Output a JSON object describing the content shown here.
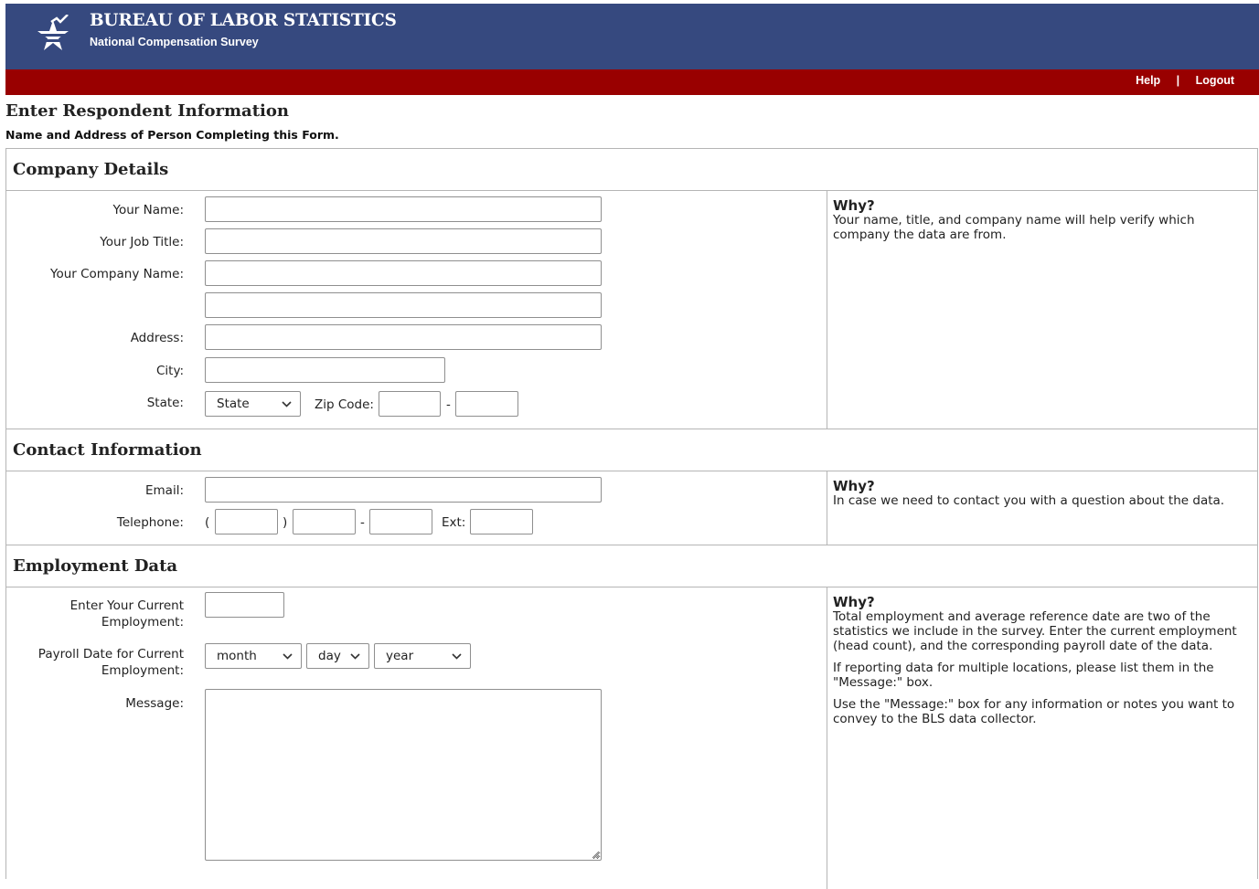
{
  "header": {
    "org_title": "BUREAU OF LABOR STATISTICS",
    "org_subtitle": "National Compensation Survey",
    "links": {
      "help": "Help",
      "separator": "|",
      "logout": "Logout"
    },
    "colors": {
      "banner": "#36497f",
      "bar": "#990000"
    }
  },
  "page": {
    "title": "Enter Respondent Information",
    "subtitle": "Name and Address of Person Completing this Form."
  },
  "company": {
    "heading": "Company Details",
    "labels": {
      "name": "Your Name:",
      "job_title": "Your Job Title:",
      "company_name": "Your Company Name:",
      "address": "Address:",
      "city": "City:",
      "state": "State:",
      "zip": "Zip Code:",
      "zip_dash": "-"
    },
    "values": {
      "name": "",
      "job_title": "",
      "company_name": "",
      "company_name_2": "",
      "address": "",
      "city": "",
      "zip": "",
      "zip_ext": ""
    },
    "state_selected": "State",
    "why": {
      "title": "Why?",
      "text": "Your name, title, and company name will help verify which company the data are from."
    }
  },
  "contact": {
    "heading": "Contact Information",
    "labels": {
      "email": "Email:",
      "telephone": "Telephone:",
      "paren_open": "(",
      "paren_close": ")",
      "dash": "-",
      "ext": "Ext:"
    },
    "values": {
      "email": "",
      "area": "",
      "prefix": "",
      "line": "",
      "ext": ""
    },
    "why": {
      "title": "Why?",
      "text": "In case we need to contact you with a question about the data."
    }
  },
  "employment": {
    "heading": "Employment Data",
    "labels": {
      "current_employment": "Enter Your Current Employment:",
      "payroll_date": "Payroll Date for Current Employment:",
      "message": "Message:"
    },
    "values": {
      "current_employment": "",
      "message": ""
    },
    "month_selected": "month",
    "day_selected": "day",
    "year_selected": "year",
    "why": {
      "title": "Why?",
      "p1": "Total employment and average reference date are two of the statistics we include in the survey. Enter the current employment (head count), and the corresponding payroll date of the data.",
      "p2": "If reporting data for multiple locations, please list them in the \"Message:\" box.",
      "p3": "Use the \"Message:\" box for any information or notes you want to convey to the BLS data collector."
    }
  },
  "icons": {
    "logo": "bls-star-logo",
    "dropdown": "chevron-down-icon",
    "resize": "resize-grip-icon"
  }
}
